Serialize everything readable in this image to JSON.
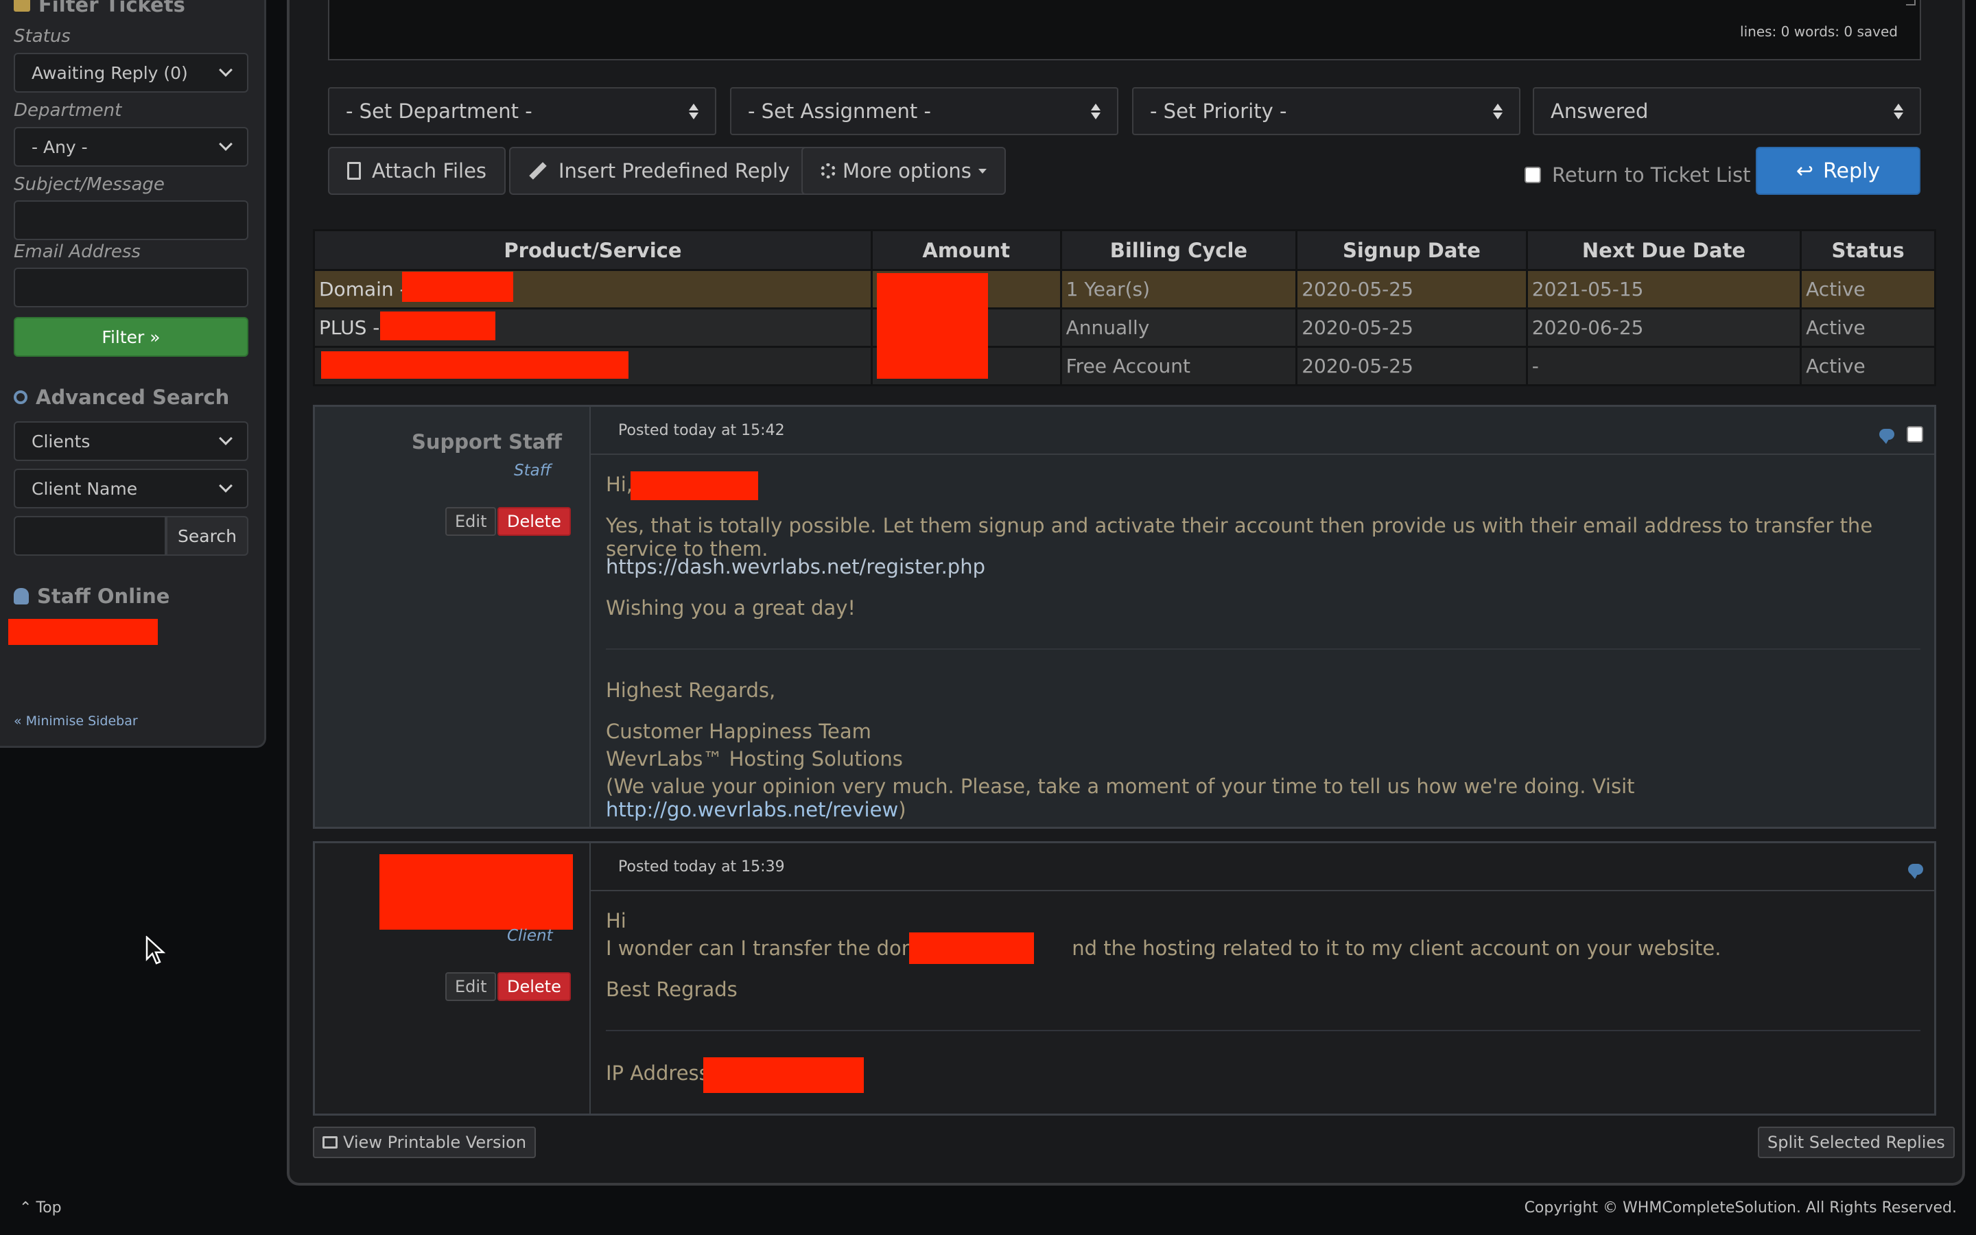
{
  "sidebar": {
    "filter_title": "Filter Tickets",
    "status_label": "Status",
    "status_value": "Awaiting Reply (0)",
    "department_label": "Department",
    "department_value": "- Any -",
    "subject_label": "Subject/Message",
    "email_label": "Email Address",
    "filter_button": "Filter »",
    "advanced_search_title": "Advanced Search",
    "search_type_value": "Clients",
    "search_field_value": "Client Name",
    "search_button": "Search",
    "staff_online_title": "Staff Online",
    "minimise_link": "« Minimise Sidebar"
  },
  "editor": {
    "counter": "lines: 0   words: 0   saved"
  },
  "dropdowns": {
    "department": "- Set Department -",
    "assignment": "- Set Assignment -",
    "priority": "- Set Priority -",
    "status": "Answered"
  },
  "actions": {
    "attach": "Attach Files",
    "predefined": "Insert Predefined Reply",
    "more": "More options",
    "return_label": "Return to Ticket List",
    "reply": "Reply"
  },
  "products_table": {
    "headers": [
      "Product/Service",
      "Amount",
      "Billing Cycle",
      "Signup Date",
      "Next Due Date",
      "Status"
    ],
    "rows": [
      {
        "product": "Domain -",
        "cycle": "1 Year(s)",
        "signup": "2020-05-25",
        "due": "2021-05-15",
        "status": "Active"
      },
      {
        "product": "PLUS -",
        "cycle": "Annually",
        "signup": "2020-05-25",
        "due": "2020-06-25",
        "status": "Active"
      },
      {
        "product": "",
        "cycle": "Free Account",
        "signup": "2020-05-25",
        "due": "-",
        "status": "Active"
      }
    ]
  },
  "posts": [
    {
      "author": "Support Staff",
      "role": "Staff",
      "posted": "Posted today at 15:42",
      "greeting": "Hi,",
      "line1": "Yes, that is totally possible. Let them signup and activate their account then provide us with their email address to transfer the service to them.",
      "link": "https://dash.wevrlabs.net/register.php",
      "line3": "Wishing you a great day!",
      "sig1": "Highest Regards,",
      "sig2": "Customer Happiness Team",
      "sig3": "WevrLabs™ Hosting Solutions",
      "sig4_pre": "(We value your opinion very much. Please, take a moment of your time to tell us how we're doing. Visit ",
      "sig4_link": "http://go.wevrlabs.net/review",
      "sig4_post": ")",
      "edit": "Edit",
      "delete": "Delete"
    },
    {
      "role": "Client",
      "posted": "Posted today at 15:39",
      "line1": "Hi",
      "line2_pre": "I wonder can I transfer the domain",
      "line2_post": "nd the hosting related to it to my client account on your website.",
      "line3": "Best Regrads",
      "ip_label": "IP Address:",
      "edit": "Edit",
      "delete": "Delete"
    }
  ],
  "footer": {
    "printable": "View Printable Version",
    "split": "Split Selected Replies",
    "top": "Top",
    "copyright": "Copyright © WHMCompleteSolution. All Rights Reserved."
  }
}
